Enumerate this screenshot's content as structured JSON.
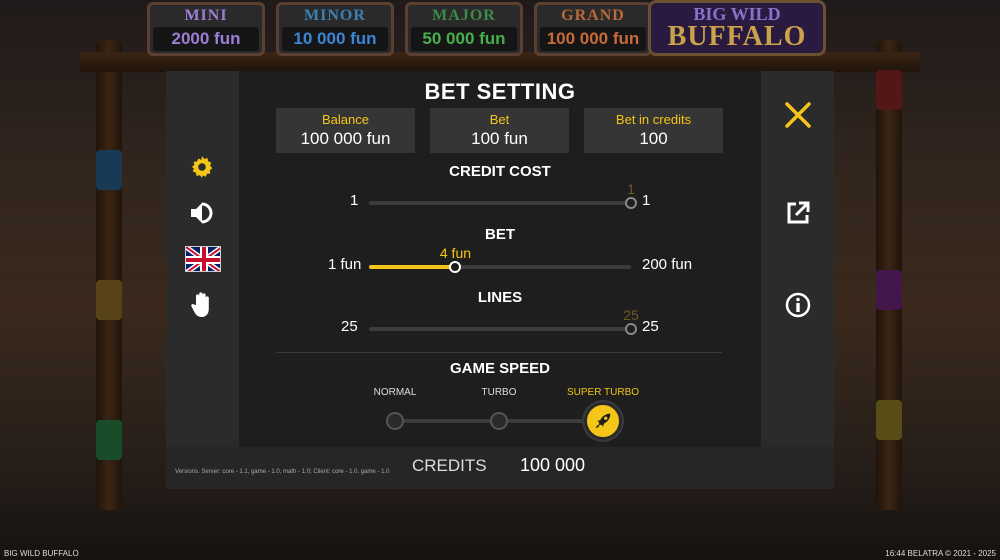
{
  "jackpots": [
    {
      "name": "MINI",
      "value": "2000 fun",
      "name_color": "#9b7fd6",
      "value_color": "#9b7fd6"
    },
    {
      "name": "MINOR",
      "value": "10 000 fun",
      "name_color": "#3b7fb3",
      "value_color": "#3b86d6"
    },
    {
      "name": "MAJOR",
      "value": "50 000 fun",
      "name_color": "#3d8a4a",
      "value_color": "#48b04a"
    },
    {
      "name": "GRAND",
      "value": "100 000 fun",
      "name_color": "#b86a3a",
      "value_color": "#c86a3a"
    }
  ],
  "logo": {
    "line1": "BIG WILD",
    "line2": "BUFFALO"
  },
  "modal": {
    "title": "BET SETTING",
    "stats": {
      "balance_label": "Balance",
      "balance_value": "100 000 fun",
      "bet_label": "Bet",
      "bet_value": "100 fun",
      "credits_label": "Bet in credits",
      "credits_value": "100"
    },
    "credit_cost": {
      "title": "CREDIT COST",
      "min": "1",
      "max": "1",
      "current": "1",
      "fraction": 1.0
    },
    "bet": {
      "title": "BET",
      "min": "1 fun",
      "max": "200 fun",
      "current": "4 fun",
      "fraction": 0.33
    },
    "lines": {
      "title": "LINES",
      "min": "25",
      "max": "25",
      "current": "25",
      "fraction": 1.0
    },
    "game_speed": {
      "title": "GAME SPEED",
      "options": [
        "NORMAL",
        "TURBO",
        "SUPER TURBO"
      ],
      "selected": "SUPER TURBO"
    },
    "bottom": {
      "version": "Versions. Server: core - 1.1, game - 1.0, math - 1.0; Client: core - 1.0, game - 1.0",
      "credits_label": "CREDITS",
      "credits_value": "100 000"
    },
    "left_icons": [
      "gear-icon",
      "sound-icon",
      "uk-flag-icon",
      "hand-icon"
    ],
    "right_icons": [
      "close-icon",
      "external-link-icon",
      "info-icon"
    ]
  },
  "footer": {
    "game_name": "BIG WILD BUFFALO",
    "right_text": "16:44  BELATRA © 2021 - 2025"
  },
  "colors": {
    "accent": "#f5c518",
    "panel": "#222222",
    "panel_side": "#2b2b2b"
  }
}
